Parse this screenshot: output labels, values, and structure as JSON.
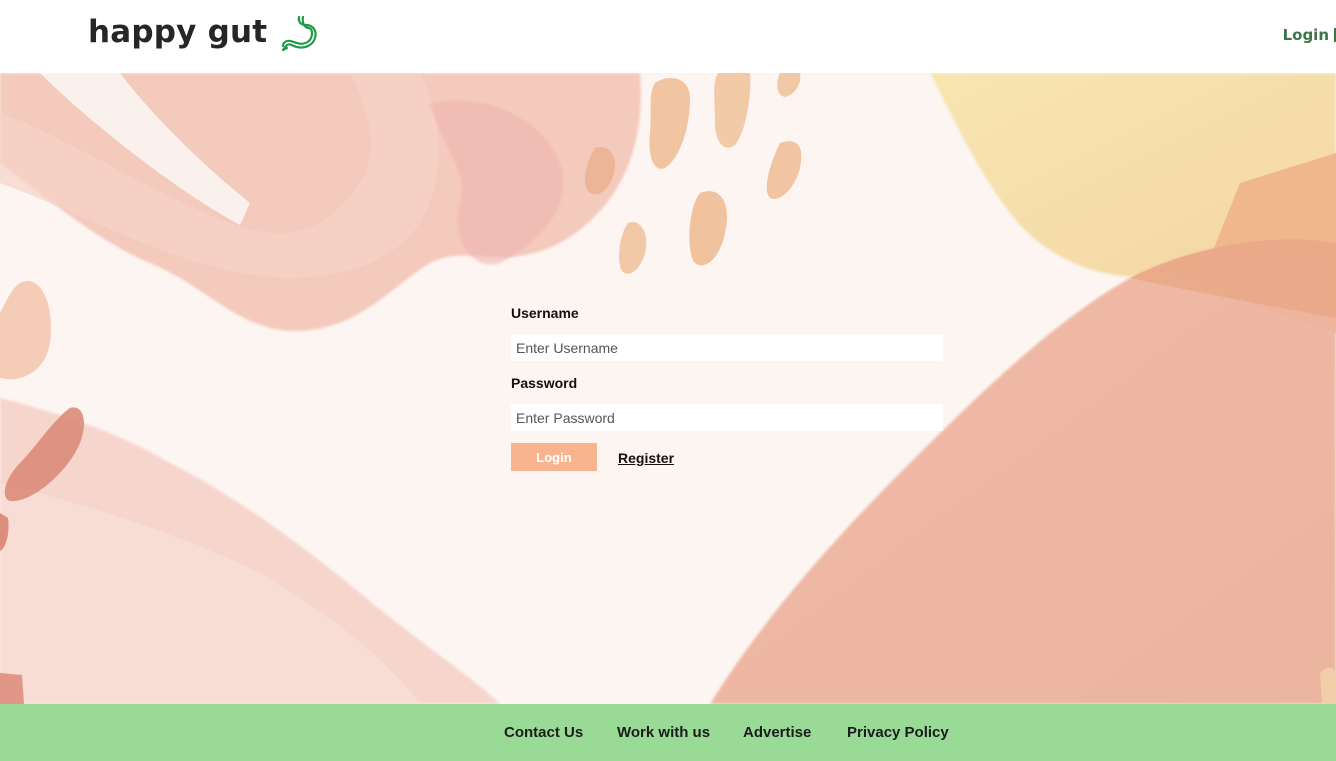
{
  "header": {
    "brand": "happy gut",
    "logo_icon": "stomach-icon",
    "nav_login": "Login"
  },
  "form": {
    "username_label": "Username",
    "username_placeholder": "Enter Username",
    "username_value": "",
    "password_label": "Password",
    "password_placeholder": "Enter Password",
    "password_value": "",
    "login_button": "Login",
    "register_link": "Register"
  },
  "footer": {
    "links": [
      "Contact Us",
      "Work with us",
      "Advertise",
      "Privacy Policy"
    ]
  },
  "colors": {
    "brand_text": "#262626",
    "nav_link": "#3f7348",
    "login_button": "#f7b48f",
    "footer_bg": "#99da96",
    "background": "#fcf5f1"
  }
}
